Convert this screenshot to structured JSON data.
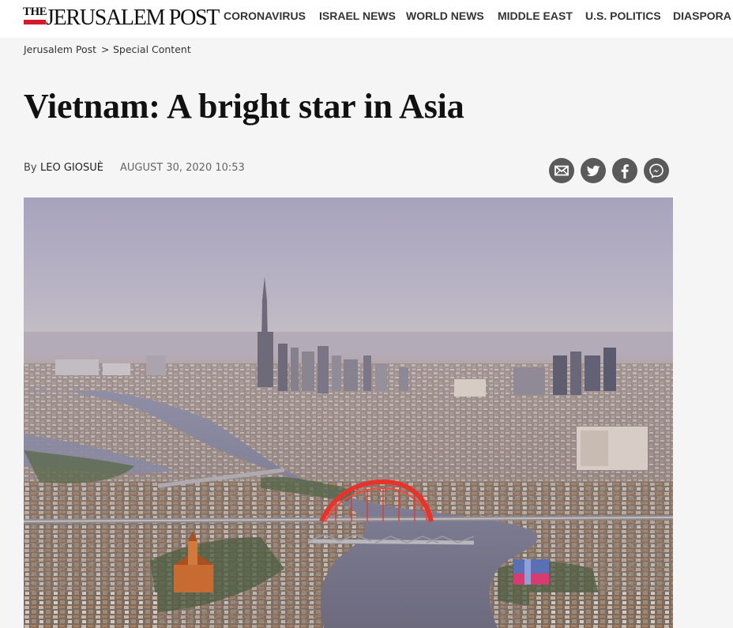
{
  "header": {
    "logo_the": "THE",
    "logo_name": "JERUSALEM POST",
    "nav": [
      "CORONAVIRUS",
      "ISRAEL NEWS",
      "WORLD NEWS",
      "MIDDLE EAST",
      "U.S. POLITICS",
      "DIASPORA"
    ]
  },
  "breadcrumb": {
    "home": "Jerusalem Post",
    "separator": ">",
    "section": "Special Content"
  },
  "article": {
    "title": "Vietnam: A bright star in Asia",
    "by_prefix": "By",
    "author": "LEO GIOSUÈ",
    "date": "AUGUST 30, 2020 10:53"
  },
  "share_icons": [
    "mail-icon",
    "twitter-icon",
    "facebook-icon",
    "messenger-icon"
  ],
  "colors": {
    "logo_red": "#d21c2a",
    "share_icon_bg": "#5a5a5a",
    "page_bg": "#f5f5f5",
    "header_bg": "#ffffff",
    "bridge_red": "#e8332c"
  }
}
